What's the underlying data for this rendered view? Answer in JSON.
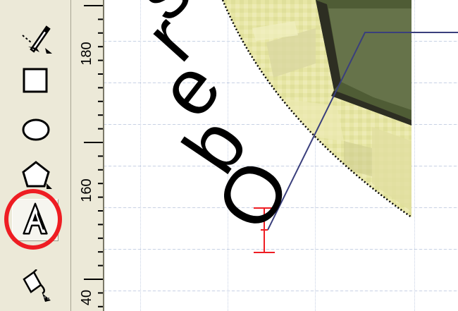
{
  "toolbox": {
    "tools": [
      {
        "name": "freehand-tool",
        "icon": "pen-arrow-icon"
      },
      {
        "name": "rectangle-tool",
        "icon": "rectangle-icon"
      },
      {
        "name": "ellipse-tool",
        "icon": "ellipse-icon"
      },
      {
        "name": "polygon-tool",
        "icon": "pentagon-icon"
      },
      {
        "name": "text-tool",
        "icon": "text-a-icon",
        "selected": true
      },
      {
        "name": "fill-tool",
        "icon": "paint-bucket-icon"
      }
    ],
    "highlight_color": "#ee1d23"
  },
  "ruler": {
    "labels": [
      "180",
      "160",
      "40"
    ]
  },
  "canvas": {
    "text_on_path": [
      "O",
      "b",
      "e",
      "r",
      "s"
    ],
    "cursor_color": "#ee1d23",
    "connector_color": "#3a3f7c"
  }
}
